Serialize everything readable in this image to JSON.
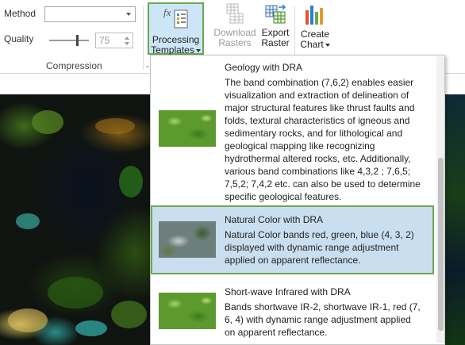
{
  "ribbon": {
    "method_label": "Method",
    "method_value": "",
    "quality_label": "Quality",
    "quality_value": "75",
    "quality_level_percent": 70,
    "compression_group": "Compression",
    "processing_templates": "Processing Templates",
    "fx_label": "fx",
    "download_rasters": "Download Rasters",
    "export_raster": "Export Raster",
    "create_chart": "Create Chart",
    "dash": "-"
  },
  "gallery": {
    "items": [
      {
        "title": "Geology with DRA",
        "description": "The band combination (7,6,2) enables easier visualization and extraction of delineation of major structural features like thrust faults and folds, textural characteristics of igneous and sedimentary rocks, and for lithological and geological mapping like recognizing hydrothermal altered rocks, etc. Additionally, various band combinations like 4,3,2 ; 7,6,5; 7,5,2; 7,4,2 etc. can also be used to determine specific geological features.",
        "selected": false
      },
      {
        "title": "Natural Color with DRA",
        "description": "Natural Color bands red, green, blue (4, 3, 2) displayed with dynamic range adjustment applied on apparent reflectance.",
        "selected": true
      },
      {
        "title": "Short-wave Infrared with DRA",
        "description": "Bands shortwave IR-2, shortwave IR-1, red (7, 6, 4) with dynamic range adjustment applied on apparent reflectance.",
        "selected": false
      }
    ]
  },
  "colors": {
    "selection_border": "#6aa84f",
    "selection_fill": "#c9dff0",
    "ribbon_active": "#cde6f7"
  }
}
